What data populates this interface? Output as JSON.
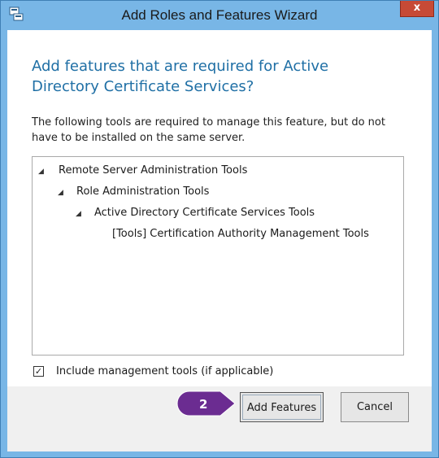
{
  "window": {
    "title": "Add Roles and Features Wizard",
    "close_glyph": "x"
  },
  "dialog": {
    "heading": "Add features that are required for Active Directory Certificate Services?",
    "description": "The following tools are required to manage this feature, but do not have to be installed on the same server."
  },
  "tree": {
    "items": [
      {
        "label": "Remote Server Administration Tools",
        "level": 0,
        "expanded": true
      },
      {
        "label": "Role Administration Tools",
        "level": 1,
        "expanded": true
      },
      {
        "label": "Active Directory Certificate Services Tools",
        "level": 2,
        "expanded": true
      },
      {
        "label": "[Tools] Certification Authority Management Tools",
        "level": 3,
        "expanded": false
      }
    ]
  },
  "options": {
    "include_tools_label": "Include management tools (if applicable)",
    "include_tools_checked": true
  },
  "buttons": {
    "add_features": "Add Features",
    "cancel": "Cancel"
  },
  "step_marker": {
    "number": "2",
    "color": "#6b2c91"
  },
  "colors": {
    "titlebar": "#78b6e6",
    "heading": "#1f6fa5",
    "close": "#c74a36"
  },
  "icons": {
    "app": "server-manager-icon",
    "expand": "expanded-arrow-icon",
    "close": "close-icon",
    "check": "checkmark-icon"
  }
}
